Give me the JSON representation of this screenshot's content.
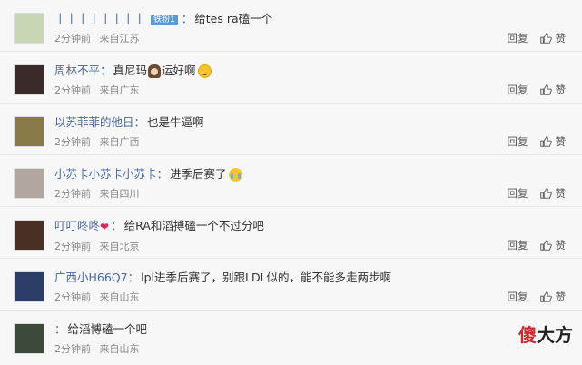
{
  "comments": [
    {
      "username": "丨丨丨丨丨丨丨丨",
      "badge": "铁粉1",
      "text": "给tes ra磕一个",
      "time": "2分钟前",
      "location": "来自江苏",
      "avatar_color": "#c9d6b6"
    },
    {
      "username": "周林不平",
      "text": "真尼玛",
      "text2": "运好啊",
      "time": "2分钟前",
      "location": "来自广东",
      "avatar_color": "#3a2a2a"
    },
    {
      "username": "以苏菲菲的他日",
      "text": "也是牛逼啊",
      "time": "2分钟前",
      "location": "来自广西",
      "avatar_color": "#8a7a4a"
    },
    {
      "username": "小苏卡小苏卡小苏卡",
      "text": "进季后赛了",
      "time": "2分钟前",
      "location": "来自四川",
      "avatar_color": "#b0a8a0"
    },
    {
      "username": "叮叮咚咚",
      "text": "给RA和滔搏磕一个不过分吧",
      "time": "2分钟前",
      "location": "来自北京",
      "avatar_color": "#4a3024"
    },
    {
      "username": "广西小H66Q7",
      "text": "lpl进季后赛了，别跟LDL似的，能不能多走两步啊",
      "time": "2分钟前",
      "location": "来自山东",
      "avatar_color": "#2b3d66"
    },
    {
      "username": "",
      "text": "给滔博磕一个吧",
      "time": "2分钟前",
      "location": "来自山东",
      "avatar_color": "#3d4a3a"
    }
  ],
  "actions": {
    "reply_label": "回复",
    "like_label": "赞"
  },
  "separator": "：",
  "watermark": {
    "red_char": "傻",
    "rest": "大方"
  }
}
